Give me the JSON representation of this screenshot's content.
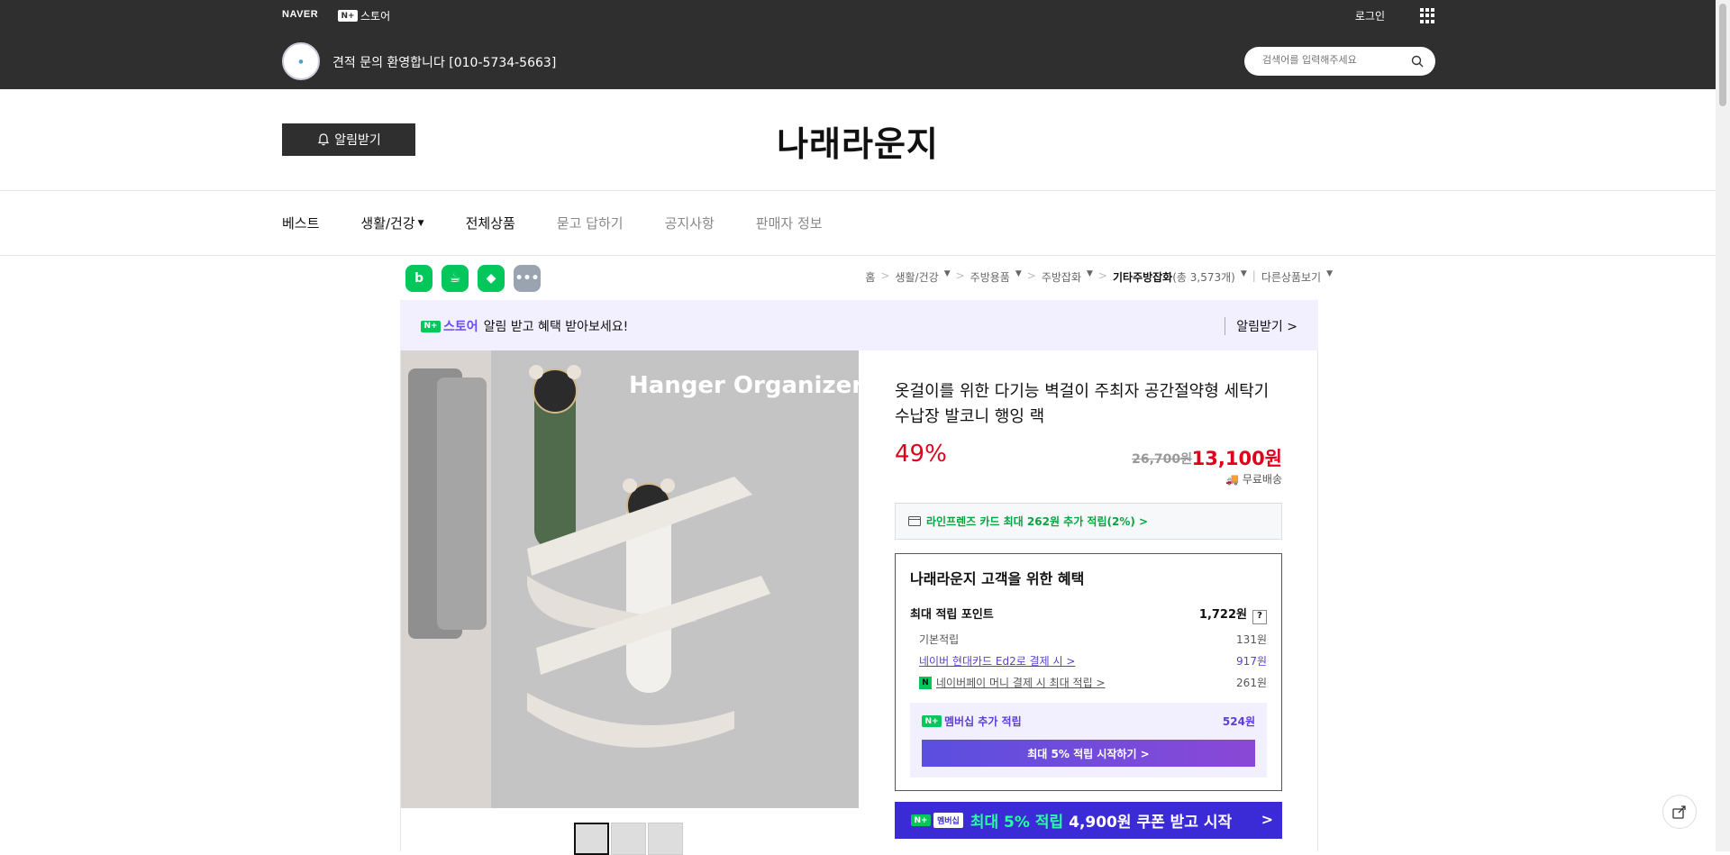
{
  "topbar": {
    "naver_logo": "NAVER",
    "nplus_badge": "N+",
    "store_label": "스토어",
    "login_label": "로그인",
    "welcome_text": "견적 문의 환영합니다 [010-5734-5663]",
    "search_placeholder": "검색어를 입력해주세요"
  },
  "header": {
    "alarm_label": "알림받기",
    "store_name": "나래라운지"
  },
  "nav": {
    "items": [
      {
        "label": "베스트"
      },
      {
        "label": "생활/건강"
      },
      {
        "label": "전체상품"
      },
      {
        "label": "묻고 답하기"
      },
      {
        "label": "공지사항"
      },
      {
        "label": "판매자 정보"
      }
    ]
  },
  "breadcrumb": {
    "home": "홈",
    "c1": "생활/건강",
    "c2": "주방용품",
    "c3": "주방잡화",
    "c4": "기타주방잡화",
    "count": "(총 3,573개)",
    "other": "다른상품보기"
  },
  "promo": {
    "nplus_badge": "N+",
    "store": "스토어",
    "text": "알림 받고 혜택 받아보세요!",
    "action": "알림받기 >"
  },
  "product": {
    "image_text": "Hanger Organizer",
    "title": "옷걸이를 위한 다기능 벽걸이 주최자 공간절약형 세탁기 수납장 발코니 행잉 랙",
    "discount": "49%",
    "original_price": "26,700원",
    "sale_price": "13,100원",
    "shipping": "무료배송",
    "card_benefit": "라인프렌즈 카드 최대 262원 추가 적립(2%) >"
  },
  "benefit": {
    "title": "나래라운지 고객을 위한 혜택",
    "max_points_label": "최대 적립 포인트",
    "max_points_value": "1,722원",
    "q_mark": "?",
    "basic_label": "기본적립",
    "basic_value": "131원",
    "card_label": "네이버 현대카드 Ed2로 결제 시 >",
    "card_value": "917원",
    "npay_badge": "N",
    "npay_label": "네이버페이 머니 결제 시 최대 적립 >",
    "npay_value": "261원",
    "member_badge": "N+",
    "member_label": "멤버십 추가 적립",
    "member_value": "524원",
    "member_button": "최대 5% 적립 시작하기 >"
  },
  "coupon": {
    "badge": "N+",
    "tag": "멤버십",
    "highlight": "최대 5% 적립",
    "text": "4,900원 쿠폰 받고 시작",
    "arrow": ">"
  },
  "colors": {
    "topbar_bg": "#2f2f2f",
    "naver_green": "#03c75a",
    "price_red": "#e0001b",
    "membership_purple": "#5a3ed6",
    "coupon_bg": "#3a2bd6"
  }
}
